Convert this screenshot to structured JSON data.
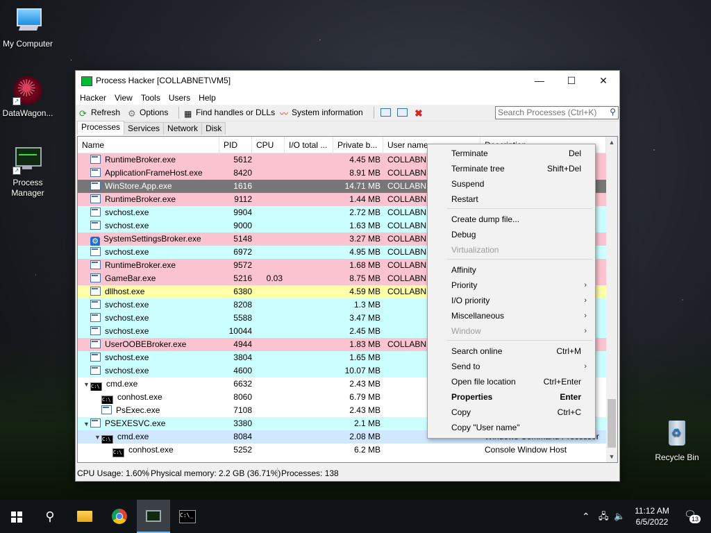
{
  "desktop": {
    "icons": [
      {
        "label": "My Computer"
      },
      {
        "label": "DataWagon..."
      },
      {
        "label": "Process\nManager"
      },
      {
        "label": "Recycle Bin"
      }
    ]
  },
  "window": {
    "title": "Process Hacker [COLLABNET\\VM5]",
    "menu": [
      "Hacker",
      "View",
      "Tools",
      "Users",
      "Help"
    ],
    "toolbar": {
      "refresh": "Refresh",
      "options": "Options",
      "find": "Find handles or DLLs",
      "sysinfo": "System information"
    },
    "search_placeholder": "Search Processes (Ctrl+K)",
    "tabs": [
      "Processes",
      "Services",
      "Network",
      "Disk"
    ],
    "columns": [
      "Name",
      "PID",
      "CPU",
      "I/O total ...",
      "Private b...",
      "User name",
      "Description"
    ],
    "rows": [
      {
        "name": "RuntimeBroker.exe",
        "pid": "5612",
        "cpu": "",
        "priv": "4.45 MB",
        "user": "COLLABNE",
        "desc": "",
        "bg": "pink"
      },
      {
        "name": "ApplicationFrameHost.exe",
        "pid": "8420",
        "cpu": "",
        "priv": "8.91 MB",
        "user": "COLLABNE",
        "desc": "",
        "bg": "pink"
      },
      {
        "name": "WinStore.App.exe",
        "pid": "1616",
        "cpu": "",
        "priv": "14.71 MB",
        "user": "COLLABNE",
        "desc": "",
        "bg": "sel"
      },
      {
        "name": "RuntimeBroker.exe",
        "pid": "9112",
        "cpu": "",
        "priv": "1.44 MB",
        "user": "COLLABNE",
        "desc": "",
        "bg": "pink"
      },
      {
        "name": "svchost.exe",
        "pid": "9904",
        "cpu": "",
        "priv": "2.72 MB",
        "user": "COLLABNE",
        "desc": "",
        "bg": "cyan"
      },
      {
        "name": "svchost.exe",
        "pid": "9000",
        "cpu": "",
        "priv": "1.63 MB",
        "user": "COLLABNE",
        "desc": "",
        "bg": "cyan"
      },
      {
        "name": "SystemSettingsBroker.exe",
        "pid": "5148",
        "cpu": "",
        "priv": "3.27 MB",
        "user": "COLLABNE",
        "desc": "",
        "bg": "pink"
      },
      {
        "name": "svchost.exe",
        "pid": "6972",
        "cpu": "",
        "priv": "4.95 MB",
        "user": "COLLABNE",
        "desc": "",
        "bg": "cyan"
      },
      {
        "name": "RuntimeBroker.exe",
        "pid": "9572",
        "cpu": "",
        "priv": "1.68 MB",
        "user": "COLLABNE",
        "desc": "",
        "bg": "pink"
      },
      {
        "name": "GameBar.exe",
        "pid": "5216",
        "cpu": "0.03",
        "priv": "8.75 MB",
        "user": "COLLABNE",
        "desc": "",
        "bg": "pink"
      },
      {
        "name": "dllhost.exe",
        "pid": "6380",
        "cpu": "",
        "priv": "4.59 MB",
        "user": "COLLABNE",
        "desc": "",
        "bg": "yellow"
      },
      {
        "name": "svchost.exe",
        "pid": "8208",
        "cpu": "",
        "priv": "1.3 MB",
        "user": "",
        "desc": "",
        "bg": "cyan"
      },
      {
        "name": "svchost.exe",
        "pid": "5588",
        "cpu": "",
        "priv": "3.47 MB",
        "user": "",
        "desc": "",
        "bg": "cyan"
      },
      {
        "name": "svchost.exe",
        "pid": "10044",
        "cpu": "",
        "priv": "2.45 MB",
        "user": "",
        "desc": "",
        "bg": "cyan"
      },
      {
        "name": "UserOOBEBroker.exe",
        "pid": "4944",
        "cpu": "",
        "priv": "1.83 MB",
        "user": "COLLABNE",
        "desc": "",
        "bg": "pink"
      },
      {
        "name": "svchost.exe",
        "pid": "3804",
        "cpu": "",
        "priv": "1.65 MB",
        "user": "",
        "desc": "",
        "bg": "cyan"
      },
      {
        "name": "svchost.exe",
        "pid": "4600",
        "cpu": "",
        "priv": "10.07 MB",
        "user": "",
        "desc": "",
        "bg": "cyan"
      },
      {
        "name": "cmd.exe",
        "pid": "6632",
        "cpu": "",
        "priv": "2.43 MB",
        "user": "",
        "desc": "",
        "bg": "white"
      },
      {
        "name": "conhost.exe",
        "pid": "8060",
        "cpu": "",
        "priv": "6.79 MB",
        "user": "",
        "desc": "",
        "bg": "white"
      },
      {
        "name": "PsExec.exe",
        "pid": "7108",
        "cpu": "",
        "priv": "2.43 MB",
        "user": "",
        "desc": "",
        "bg": "white"
      },
      {
        "name": "PSEXESVC.exe",
        "pid": "3380",
        "cpu": "",
        "priv": "2.1 MB",
        "user": "",
        "desc": "",
        "bg": "cyan"
      },
      {
        "name": "cmd.exe",
        "pid": "8084",
        "cpu": "",
        "priv": "2.08 MB",
        "user": "",
        "desc": "Windows Command Processor",
        "bg": "lcyan"
      },
      {
        "name": "conhost.exe",
        "pid": "5252",
        "cpu": "",
        "priv": "6.2 MB",
        "user": "",
        "desc": "Console Window Host",
        "bg": "white"
      }
    ],
    "status": {
      "cpu": "CPU Usage: 1.60%",
      "mem": "Physical memory: 2.2 GB (36.71%)",
      "procs": "Processes: 138"
    }
  },
  "context_menu": [
    {
      "label": "Terminate",
      "shortcut": "Del"
    },
    {
      "label": "Terminate tree",
      "shortcut": "Shift+Del"
    },
    {
      "label": "Suspend",
      "shortcut": ""
    },
    {
      "label": "Restart",
      "shortcut": ""
    },
    {
      "label": "Create dump file...",
      "shortcut": ""
    },
    {
      "label": "Debug",
      "shortcut": ""
    },
    {
      "label": "Virtualization",
      "shortcut": ""
    },
    {
      "label": "Affinity",
      "shortcut": ""
    },
    {
      "label": "Priority",
      "shortcut": ""
    },
    {
      "label": "I/O priority",
      "shortcut": ""
    },
    {
      "label": "Miscellaneous",
      "shortcut": ""
    },
    {
      "label": "Window",
      "shortcut": ""
    },
    {
      "label": "Search online",
      "shortcut": "Ctrl+M"
    },
    {
      "label": "Send to",
      "shortcut": ""
    },
    {
      "label": "Open file location",
      "shortcut": "Ctrl+Enter"
    },
    {
      "label": "Properties",
      "shortcut": "Enter"
    },
    {
      "label": "Copy",
      "shortcut": "Ctrl+C"
    },
    {
      "label": "Copy \"User name\"",
      "shortcut": ""
    }
  ],
  "taskbar": {
    "time": "11:12 AM",
    "date": "6/5/2022",
    "notification_count": "13"
  }
}
